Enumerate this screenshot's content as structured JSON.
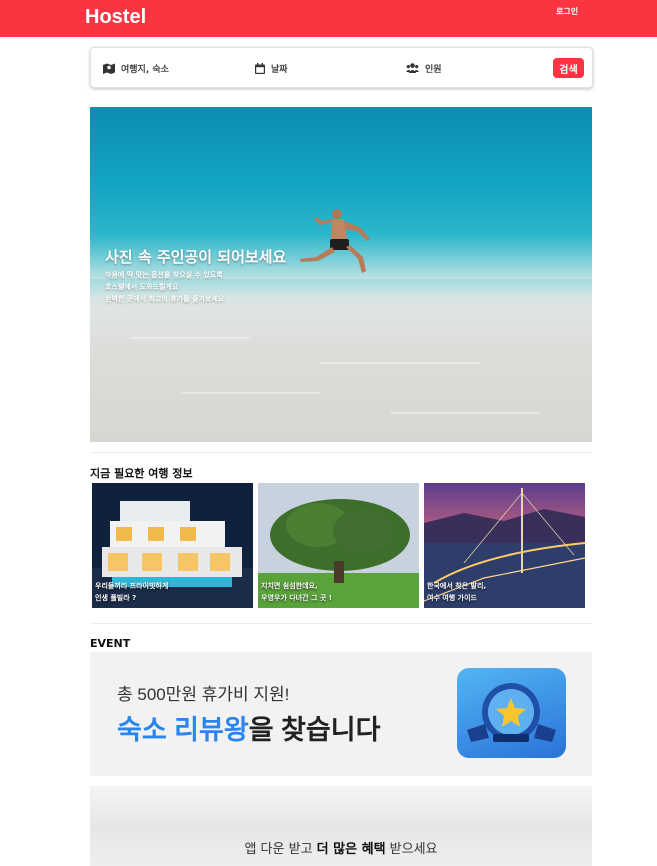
{
  "header": {
    "logo": "Hostel",
    "login": "로그인",
    "bg_color": "#fb3441"
  },
  "search": {
    "destination_placeholder": "여행지, 숙소",
    "date_placeholder": "날짜",
    "guests_placeholder": "인원",
    "button": "검색",
    "icons": [
      "map-icon",
      "calendar-icon",
      "users-icon"
    ]
  },
  "hero": {
    "title": "사진 속 주인공이 되어보세요",
    "lines": [
      "마음에 딱 맞는 옵션을 찾으실 수 있도록",
      "호스텔에서 도와드릴게요",
      "완벽한 곳에서 최고의 휴가를 즐겨보세요"
    ]
  },
  "travel": {
    "heading": "지금 필요한 여행 정보",
    "cards": [
      {
        "caption_line1": "우리들끼리 프라이빗하게",
        "caption_line2": "인생 풀빌라 ?"
      },
      {
        "caption_line1": "지치면 쉼섬한데요,",
        "caption_line2": "우영우가 다녀간 그 곳 !"
      },
      {
        "caption_line1": "한국에서 찾은 발리,",
        "caption_line2": "여수 여행 가이드"
      }
    ]
  },
  "event": {
    "heading": "EVENT",
    "banner_sub": "총 500만원 휴가비 지원!",
    "banner_highlight": "숙소 리뷰왕",
    "banner_rest": "을 찾습니다",
    "badge_label": "숙소 리뷰왕",
    "accent_color": "#2a86ee"
  },
  "promo": {
    "text_pre": "앱 다운 받고 ",
    "text_bold": "더 많은 혜택",
    "text_post": " 받으세요"
  }
}
